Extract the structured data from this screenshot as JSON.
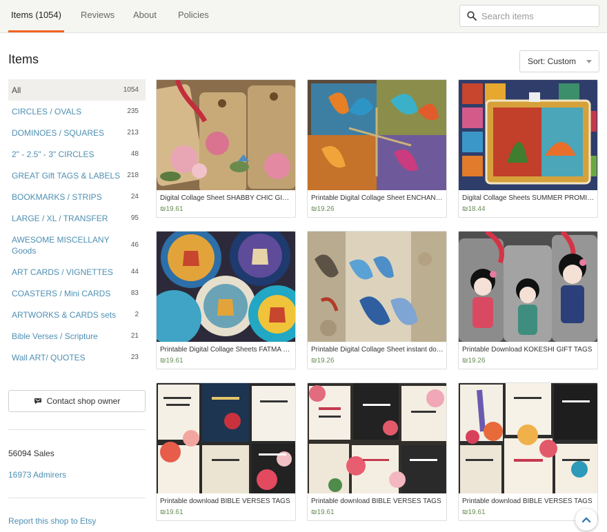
{
  "tabs": [
    {
      "label": "Items (1054)",
      "active": true
    },
    {
      "label": "Reviews",
      "active": false
    },
    {
      "label": "About",
      "active": false
    },
    {
      "label": "Policies",
      "active": false
    }
  ],
  "search": {
    "placeholder": "Search items",
    "value": "",
    "icon": "search-icon"
  },
  "items_title": "Items",
  "sort": {
    "label": "Sort: Custom"
  },
  "sections": [
    {
      "label": "All",
      "count": "1054",
      "active": true
    },
    {
      "label": "CIRCLES / OVALS",
      "count": "235"
    },
    {
      "label": "DOMINOES / SQUARES",
      "count": "213"
    },
    {
      "label": "2\" - 2.5\" - 3\" CIRCLES",
      "count": "48"
    },
    {
      "label": "GREAT Gift TAGS & LABELS",
      "count": "218"
    },
    {
      "label": "BOOKMARKS / STRIPS",
      "count": "24"
    },
    {
      "label": "LARGE / XL / TRANSFER",
      "count": "95"
    },
    {
      "label": "AWESOME MISCELLANY Goods",
      "count": "46"
    },
    {
      "label": "ART CARDS / VIGNETTES",
      "count": "44"
    },
    {
      "label": "COASTERS / Mini CARDS",
      "count": "83"
    },
    {
      "label": "ARTWORKS & CARDS sets",
      "count": "2"
    },
    {
      "label": "Bible Verses / Scripture",
      "count": "21"
    },
    {
      "label": "Wall ART/ QUOTES",
      "count": "23"
    }
  ],
  "contact": {
    "label": "Contact shop owner",
    "icon": "message-icon"
  },
  "stats": {
    "sales": "56094 Sales",
    "admirers": "16973 Admirers"
  },
  "report": "Report this shop to Etsy",
  "listings": [
    {
      "title": "Digital Collage Sheet SHABBY CHIC GIFT TAGS",
      "price": "₪19.61"
    },
    {
      "title": "Printable Digital Collage Sheet ENCHANTED BUTTERFLIES",
      "price": "₪19.26"
    },
    {
      "title": "Digital Collage Sheets SUMMER PROMISES",
      "price": "₪18.44"
    },
    {
      "title": "Printable Digital Collage Sheets FATMA HAMSA",
      "price": "₪19.61"
    },
    {
      "title": "Printable Digital Collage Sheet instant download",
      "price": "₪19.26"
    },
    {
      "title": "Printable Download KOKESHI GIFT TAGS",
      "price": "₪19.26"
    },
    {
      "title": "Printable download BIBLE VERSES TAGS",
      "price": "₪19.61"
    },
    {
      "title": "Printable download BIBLE VERSES TAGS",
      "price": "₪19.61"
    },
    {
      "title": "Printable download BIBLE VERSES TAGS",
      "price": "₪19.61"
    }
  ],
  "colors": {
    "accent": "#f1641e",
    "link": "#4d8fb3",
    "price": "#6a8a56"
  }
}
